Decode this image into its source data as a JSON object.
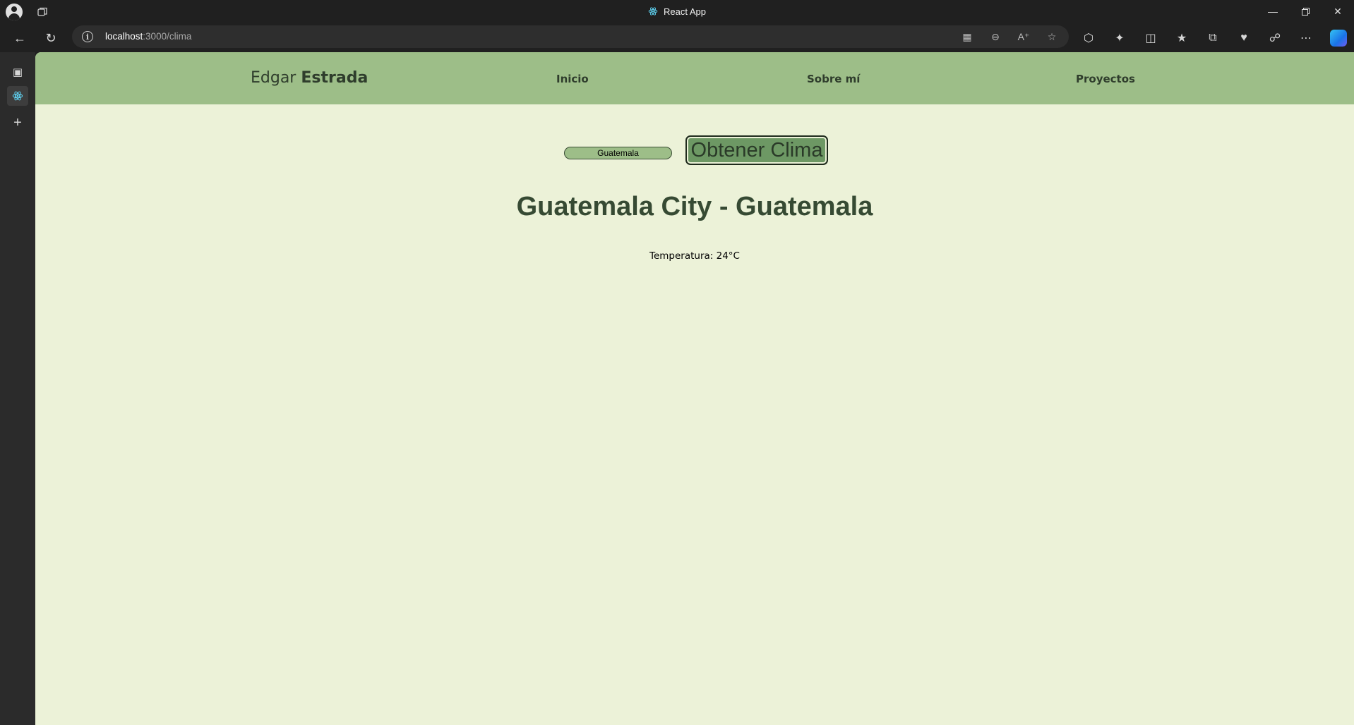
{
  "window": {
    "title": "React App"
  },
  "browser": {
    "url_host": "localhost",
    "url_path": ":3000/clima"
  },
  "site": {
    "brand_first": "Edgar",
    "brand_last": "Estrada",
    "nav": [
      "Inicio",
      "Sobre mí",
      "Proyectos"
    ]
  },
  "weather": {
    "input_value": "Guatemala",
    "button_label": "Obtener Clima",
    "city_title": "Guatemala City - Guatemala",
    "temperature": "Temperatura: 24°C"
  },
  "colors": {
    "header_bg": "#9dbe88",
    "page_bg": "#ecf2d8",
    "button_bg": "#6d9864",
    "title_text": "#364a33"
  }
}
